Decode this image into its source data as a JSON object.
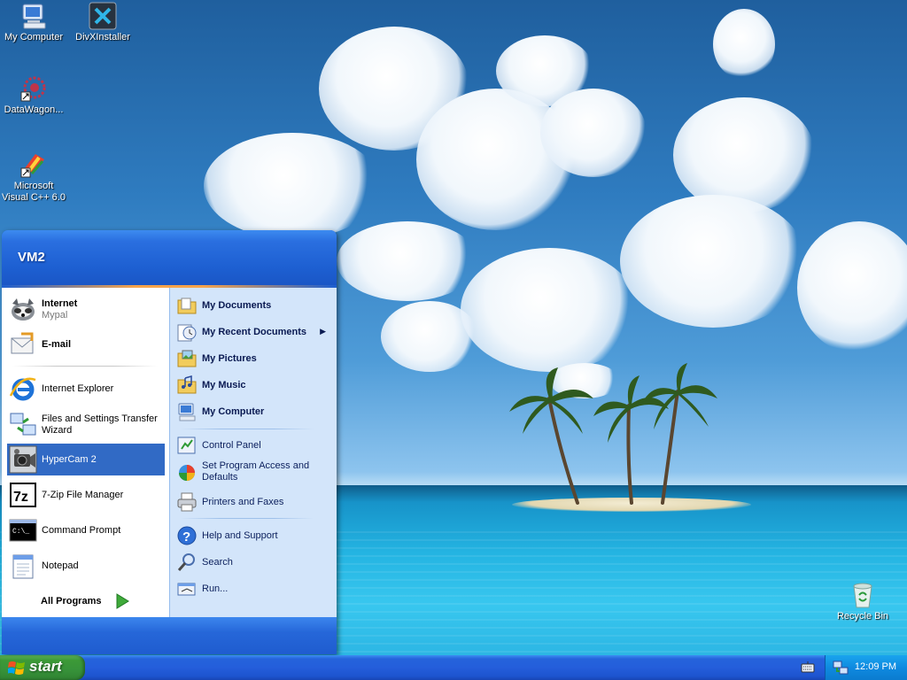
{
  "desktop": {
    "icons": [
      {
        "label": "My Computer",
        "icon": "my-computer-icon"
      },
      {
        "label": "DivXInstaller",
        "icon": "divx-icon"
      },
      {
        "label": "DataWagon...",
        "icon": "datawagon-icon"
      },
      {
        "label": "Microsoft Visual C++ 6.0",
        "icon": "visual-cpp-icon"
      },
      {
        "label": "Recycle Bin",
        "icon": "recycle-bin-icon"
      }
    ]
  },
  "start_menu": {
    "user_name": "VM2",
    "pinned": [
      {
        "label": "Internet",
        "sub": "Mypal",
        "icon": "mypal-icon"
      },
      {
        "label": "E-mail",
        "icon": "email-icon"
      }
    ],
    "recent": [
      {
        "label": "Internet Explorer",
        "icon": "internet-explorer-icon"
      },
      {
        "label": "Files and Settings Transfer Wizard",
        "icon": "transfer-wizard-icon"
      },
      {
        "label": "HyperCam 2",
        "icon": "hypercam-icon",
        "selected": true
      },
      {
        "label": "7-Zip File Manager",
        "icon": "7zip-icon"
      },
      {
        "label": "Command Prompt",
        "icon": "command-prompt-icon"
      },
      {
        "label": "Notepad",
        "icon": "notepad-icon"
      }
    ],
    "all_programs_label": "All Programs",
    "places": [
      {
        "label": "My Documents",
        "icon": "folder-documents-icon"
      },
      {
        "label": "My Recent Documents",
        "icon": "recent-documents-icon",
        "has_submenu": true
      },
      {
        "label": "My Pictures",
        "icon": "folder-pictures-icon"
      },
      {
        "label": "My Music",
        "icon": "folder-music-icon"
      },
      {
        "label": "My Computer",
        "icon": "computer-icon"
      }
    ],
    "system": [
      {
        "label": "Control Panel",
        "icon": "control-panel-icon"
      },
      {
        "label": "Set Program Access and Defaults",
        "icon": "program-access-icon"
      },
      {
        "label": "Printers and Faxes",
        "icon": "printer-icon"
      }
    ],
    "help": [
      {
        "label": "Help and Support",
        "icon": "help-icon"
      },
      {
        "label": "Search",
        "icon": "search-icon"
      },
      {
        "label": "Run...",
        "icon": "run-icon"
      }
    ],
    "submenu_arrow": "▶"
  },
  "taskbar": {
    "start_label": "start",
    "clock": "12:09 PM"
  },
  "colors": {
    "taskbar_blue": "#245edb",
    "start_green": "#3c9a37",
    "selection": "#316ac5",
    "right_pane": "#d3e5fa"
  }
}
